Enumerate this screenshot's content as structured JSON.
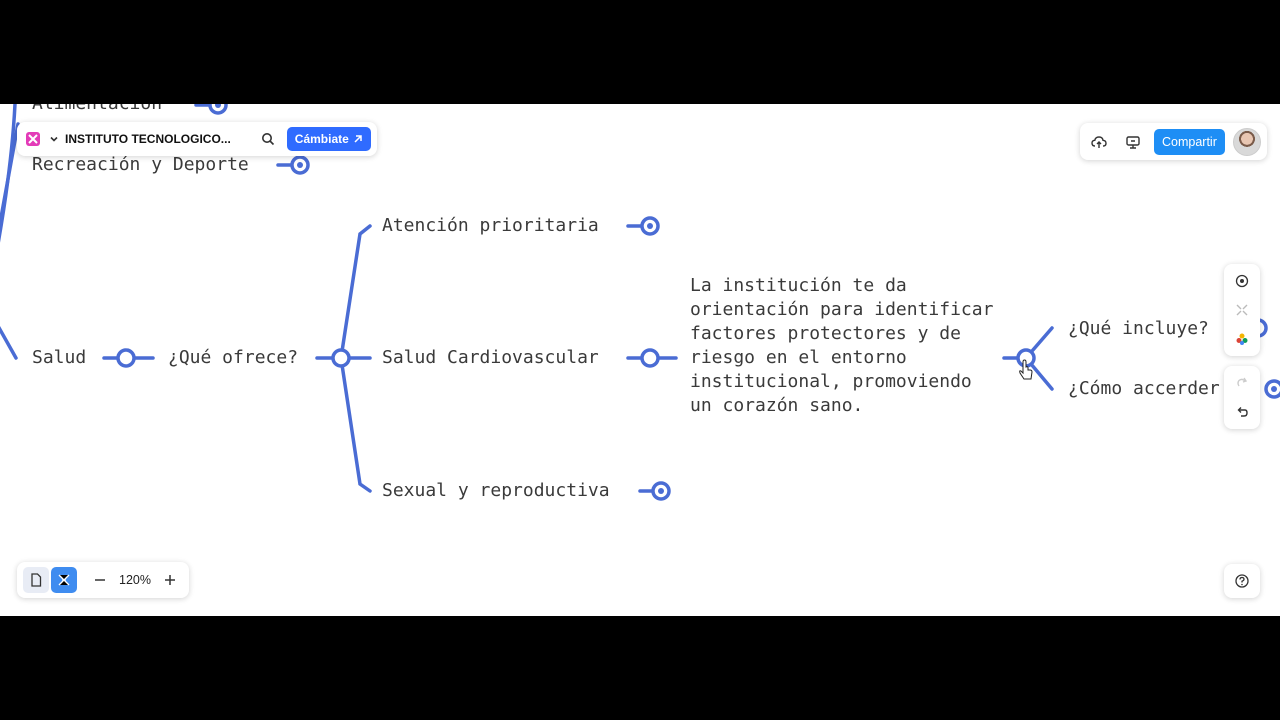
{
  "toolbar": {
    "workspace_name": "INSTITUTO TECNOLOGICO...",
    "upgrade_label": "Cámbiate",
    "share_label": "Compartir",
    "zoom_level": "120%",
    "accent_color": "#2f6bff"
  },
  "mindmap": {
    "line_color": "#4a6cd4",
    "nodes": {
      "alimentacion": "Alimentación",
      "recreacion": "Recreación y Deporte",
      "salud": "Salud",
      "que_ofrece": "¿Qué ofrece?",
      "atencion": "Atención prioritaria",
      "cardiovascular": "Salud Cardiovascular",
      "sexual": "Sexual y reproductiva",
      "descripcion": "La institución te da orientación para identificar factores protectores y de riesgo en el entorno institucional, promoviendo un corazón sano.",
      "que_incluye": "¿Qué incluye?",
      "como_acceder": "¿Cómo accerder"
    }
  },
  "icons": {
    "logo": "app-logo-icon",
    "chevron": "chevron-down-icon",
    "search": "search-icon",
    "upgrade_arrow": "arrow-up-right-icon",
    "cloud": "cloud-upload-icon",
    "present": "present-icon",
    "focus": "target-icon",
    "collapse": "collapse-icon",
    "color": "color-palette-icon",
    "redo": "redo-icon",
    "undo": "undo-icon",
    "page": "page-view-icon",
    "mindmap_view": "mindmap-view-icon",
    "zoom_out": "minus-icon",
    "zoom_in": "plus-icon",
    "help": "help-icon"
  }
}
